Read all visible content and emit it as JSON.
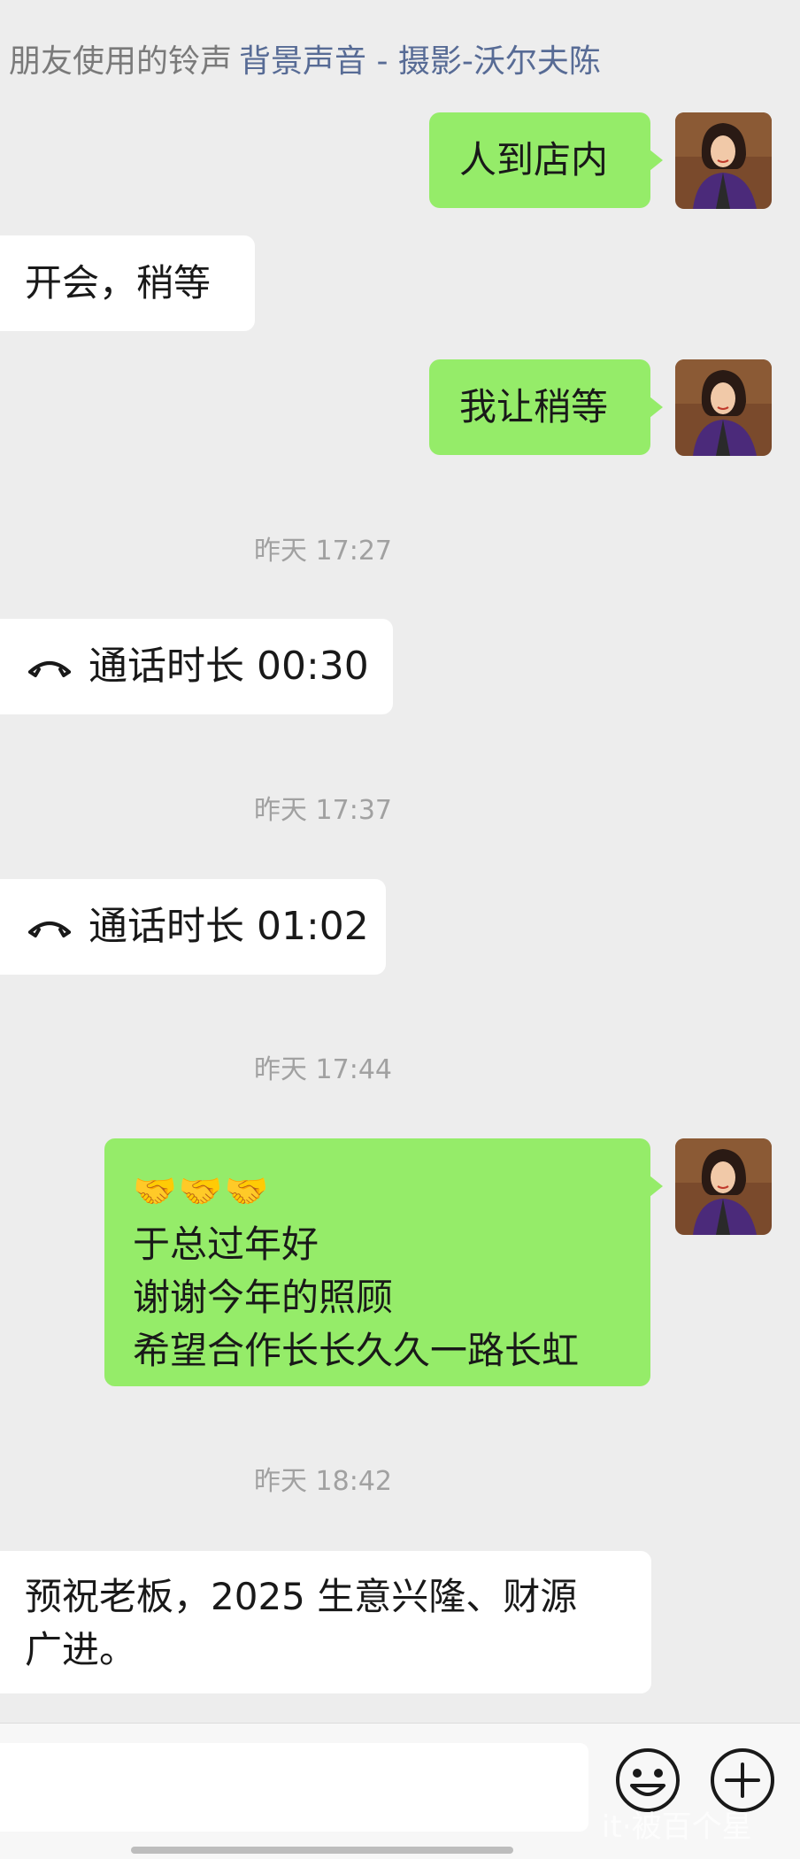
{
  "ringtone": {
    "label": "朋友使用的铃声",
    "song": "背景声音 - 摄影-沃尔夫陈"
  },
  "messages": [
    {
      "from": "me",
      "text": "人到店内"
    },
    {
      "from": "them",
      "text": "开会，稍等"
    },
    {
      "from": "me",
      "text": "我让稍等"
    }
  ],
  "timestamps": [
    "昨天 17:27",
    "昨天 17:37",
    "昨天 17:44",
    "昨天 18:42"
  ],
  "calls": [
    {
      "text": "通话时长 00:30",
      "icon": "phone-hangup-icon"
    },
    {
      "text": "通话时长 01:02",
      "icon": "phone-hangup-icon"
    }
  ],
  "greeting": {
    "emoji": "🤝🤝🤝",
    "lines": [
      "于总过年好",
      "谢谢今年的照顾",
      "希望合作长长久久一路长虹"
    ]
  },
  "reply": {
    "lines": [
      "预祝老板，2025 生意兴隆、财源",
      "广进。"
    ]
  },
  "input": {
    "value": "",
    "placeholder": ""
  },
  "icons": {
    "emoji_button": "smiley-icon",
    "more_button": "plus-circle-icon",
    "avatar": "avatar-illustration"
  },
  "watermark": "it·被百个星",
  "colors": {
    "background": "#ededed",
    "sent_bubble": "#95ec69",
    "received_bubble": "#ffffff",
    "link": "#576b95"
  }
}
